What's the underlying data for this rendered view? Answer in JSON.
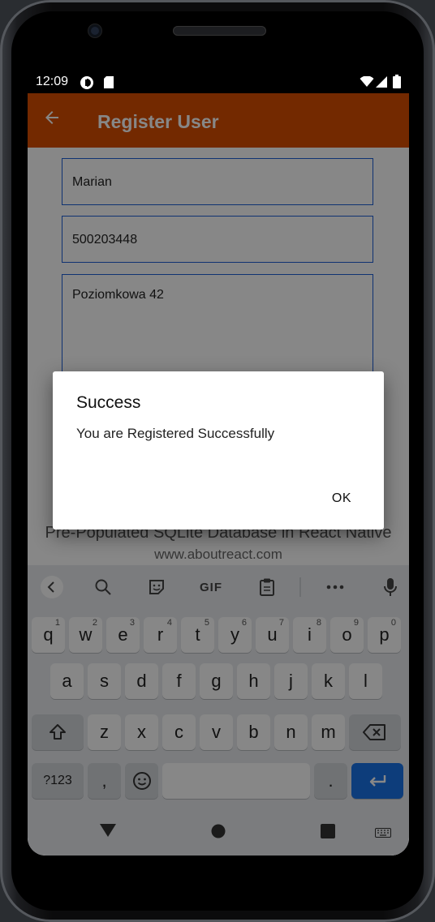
{
  "status_bar": {
    "time": "12:09"
  },
  "app_bar": {
    "title": "Register User"
  },
  "form": {
    "name_value": "Marian",
    "phone_value": "500203448",
    "address_value": "Poziomkowa 42"
  },
  "footer": {
    "title": "Pre-Populated SQLite Database in React Native",
    "url": "www.aboutreact.com"
  },
  "dialog": {
    "title": "Success",
    "message": "You are Registered Successfully",
    "ok_label": "OK"
  },
  "keyboard": {
    "toolbar": {
      "gif_label": "GIF"
    },
    "row1": [
      {
        "label": "q",
        "hint": "1"
      },
      {
        "label": "w",
        "hint": "2"
      },
      {
        "label": "e",
        "hint": "3"
      },
      {
        "label": "r",
        "hint": "4"
      },
      {
        "label": "t",
        "hint": "5"
      },
      {
        "label": "y",
        "hint": "6"
      },
      {
        "label": "u",
        "hint": "7"
      },
      {
        "label": "i",
        "hint": "8"
      },
      {
        "label": "o",
        "hint": "9"
      },
      {
        "label": "p",
        "hint": "0"
      }
    ],
    "row2": [
      "a",
      "s",
      "d",
      "f",
      "g",
      "h",
      "j",
      "k",
      "l"
    ],
    "row3": [
      "z",
      "x",
      "c",
      "v",
      "b",
      "n",
      "m"
    ],
    "symbols_label": "?123",
    "comma_label": ",",
    "period_label": "."
  },
  "colors": {
    "app_bar": "#d94f00",
    "field_border": "#1e5fd8",
    "enter_key": "#1a73e8"
  }
}
